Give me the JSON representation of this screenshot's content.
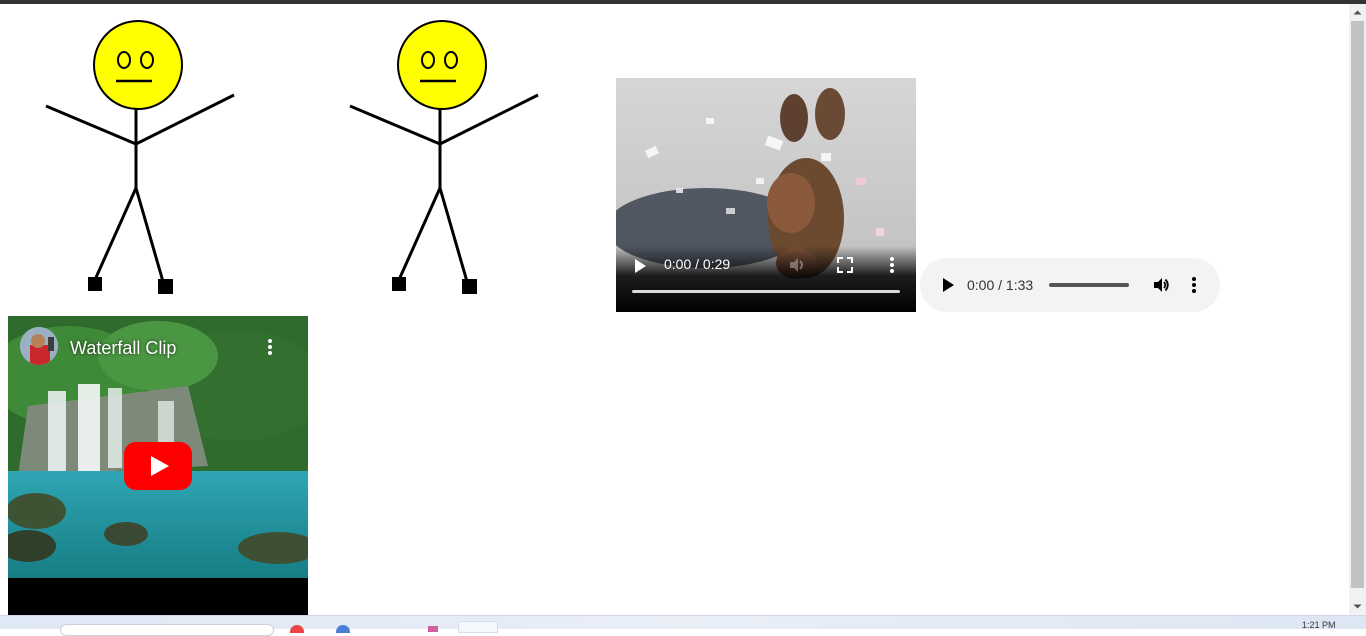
{
  "video": {
    "time": "0:00 / 0:29"
  },
  "audio": {
    "time": "0:00 / 1:33"
  },
  "youtube": {
    "title": "Waterfall Clip"
  },
  "taskbar": {
    "clock": "1:21 PM"
  },
  "colors": {
    "face": "#ffff00",
    "youtube_red": "#ff0000",
    "audio_bg": "#f1f3f4"
  }
}
